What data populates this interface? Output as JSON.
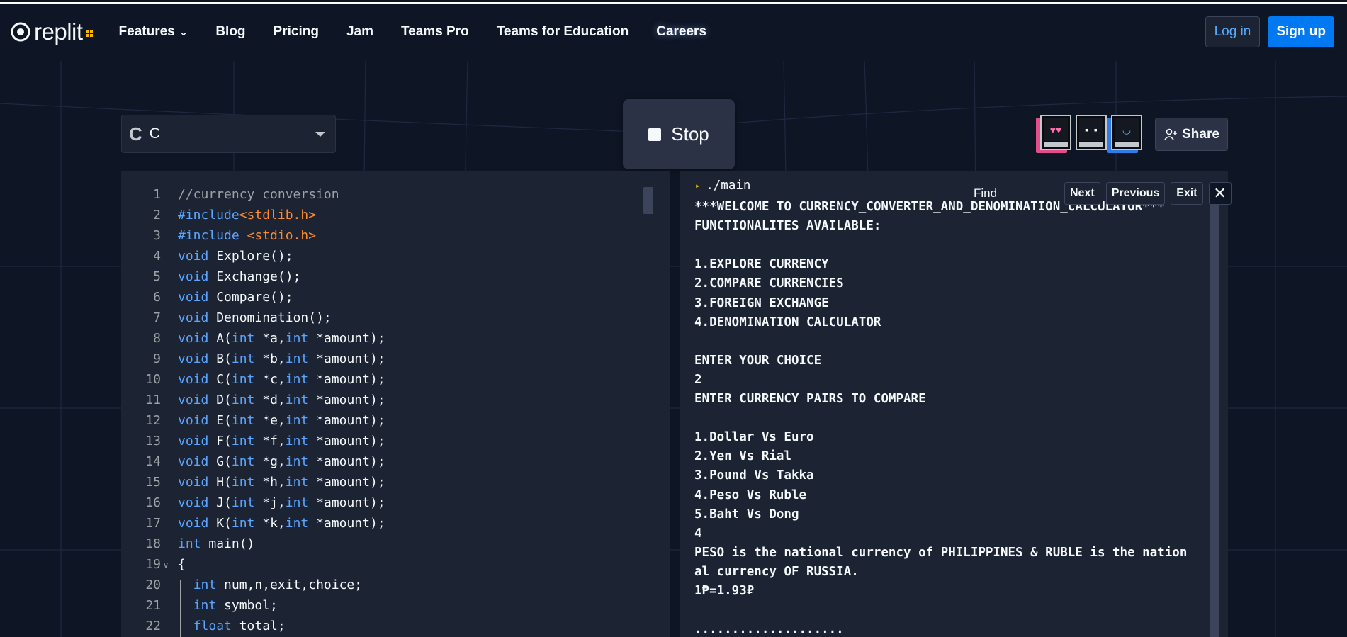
{
  "nav": {
    "logo_text": "replit",
    "links": [
      {
        "label": "Features",
        "has_dropdown": true
      },
      {
        "label": "Blog"
      },
      {
        "label": "Pricing"
      },
      {
        "label": "Jam"
      },
      {
        "label": "Teams Pro"
      },
      {
        "label": "Teams for Education"
      },
      {
        "label": "Careers"
      }
    ],
    "login_label": "Log in",
    "signup_label": "Sign up"
  },
  "toolbar": {
    "language_label": "C",
    "stop_label": "Stop",
    "share_label": "Share",
    "avatar_faces": [
      "♥♥",
      "▪_▪",
      "◡"
    ]
  },
  "editor": {
    "lines": [
      {
        "n": "1",
        "code": "//currency conversion"
      },
      {
        "n": "2",
        "code": "#include<stdlib.h>"
      },
      {
        "n": "3",
        "code": "#include <stdio.h>"
      },
      {
        "n": "4",
        "code": "void Explore();"
      },
      {
        "n": "5",
        "code": "void Exchange();"
      },
      {
        "n": "6",
        "code": "void Compare();"
      },
      {
        "n": "7",
        "code": "void Denomination();"
      },
      {
        "n": "8",
        "code": "void A(int *a,int *amount);"
      },
      {
        "n": "9",
        "code": "void B(int *b,int *amount);"
      },
      {
        "n": "10",
        "code": "void C(int *c,int *amount);"
      },
      {
        "n": "11",
        "code": "void D(int *d,int *amount);"
      },
      {
        "n": "12",
        "code": "void E(int *e,int *amount);"
      },
      {
        "n": "13",
        "code": "void F(int *f,int *amount);"
      },
      {
        "n": "14",
        "code": "void G(int *g,int *amount);"
      },
      {
        "n": "15",
        "code": "void H(int *h,int *amount);"
      },
      {
        "n": "16",
        "code": "void J(int *j,int *amount);"
      },
      {
        "n": "17",
        "code": "void K(int *k,int *amount);"
      },
      {
        "n": "18",
        "code": "int main()"
      },
      {
        "n": "19",
        "code": "{"
      },
      {
        "n": "20",
        "code": "  int num,n,exit,choice;"
      },
      {
        "n": "21",
        "code": "  int symbol;"
      },
      {
        "n": "22",
        "code": "  float total;"
      }
    ]
  },
  "console": {
    "prompt": "./main",
    "lines": [
      "***WELCOME TO CURRENCY_CONVERTER_AND_DENOMINATION_CALCULATOR***",
      "FUNCTIONALITES AVAILABLE:",
      "",
      "1.EXPLORE CURRENCY",
      "2.COMPARE CURRENCIES",
      "3.FOREIGN EXCHANGE",
      "4.DENOMINATION CALCULATOR",
      "",
      "ENTER YOUR CHOICE",
      "2",
      "ENTER CURRENCY PAIRS TO COMPARE",
      "",
      "1.Dollar Vs Euro",
      "2.Yen Vs Rial",
      "3.Pound Vs Takka",
      "4.Peso Vs Ruble",
      "5.Baht Vs Dong",
      "4",
      "PESO is the national currency of PHILIPPINES & RUBLE is the nation",
      "al currency OF RUSSIA.",
      "1₱=1.93₽",
      "",
      "...................."
    ]
  },
  "find": {
    "label": "Find",
    "next_label": "Next",
    "previous_label": "Previous",
    "exit_label": "Exit",
    "close_glyph": "✕"
  }
}
